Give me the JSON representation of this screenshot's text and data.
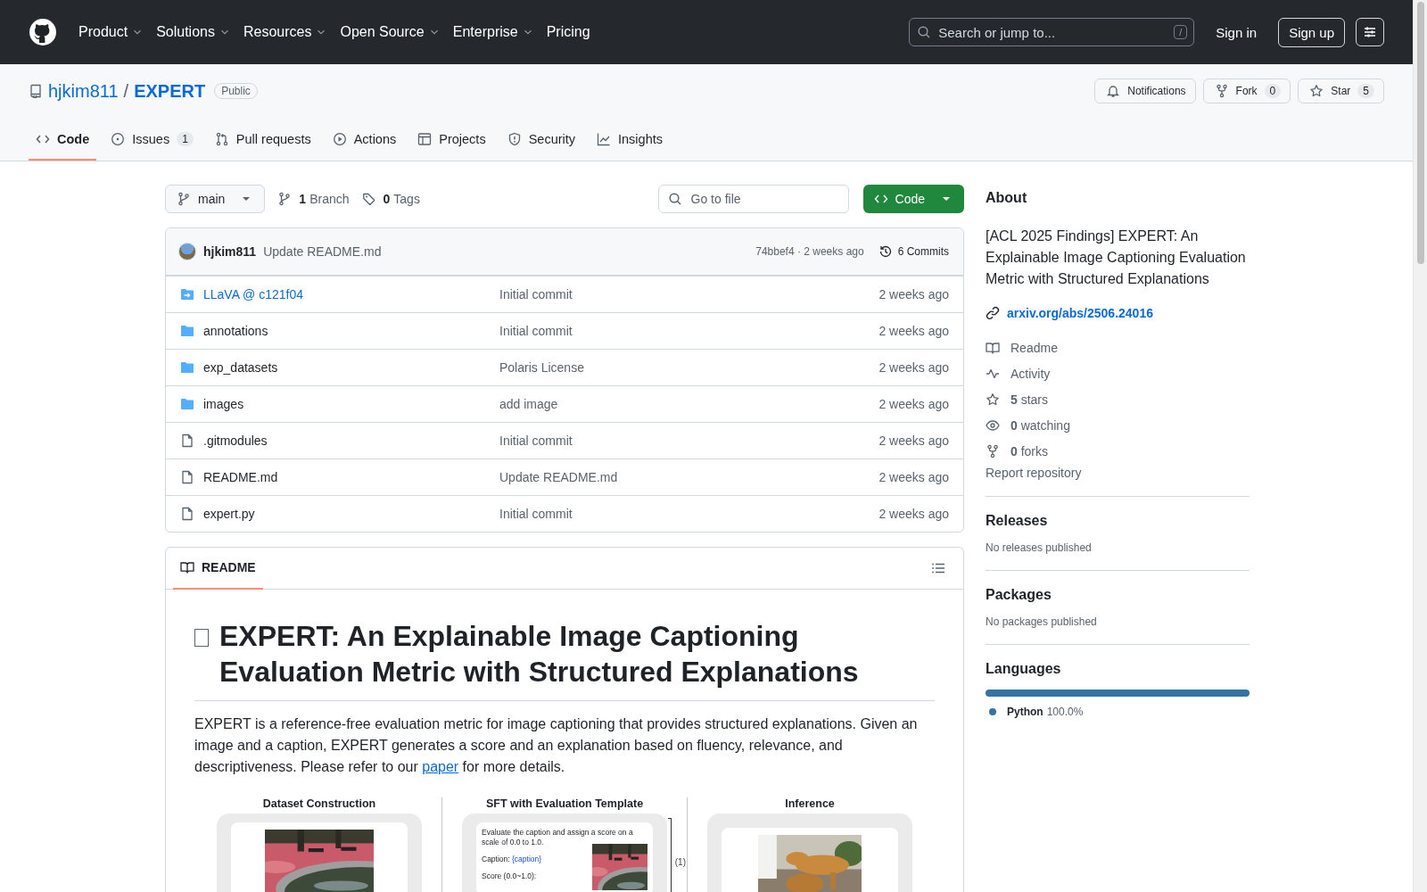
{
  "header": {
    "nav": [
      {
        "label": "Product",
        "has_menu": true
      },
      {
        "label": "Solutions",
        "has_menu": true
      },
      {
        "label": "Resources",
        "has_menu": true
      },
      {
        "label": "Open Source",
        "has_menu": true
      },
      {
        "label": "Enterprise",
        "has_menu": true
      },
      {
        "label": "Pricing",
        "has_menu": false
      }
    ],
    "search": {
      "placeholder": "Search or jump to...",
      "shortcut": "/"
    },
    "sign_in": "Sign in",
    "sign_up": "Sign up"
  },
  "repo": {
    "owner": "hjkim811",
    "separator": "/",
    "name": "EXPERT",
    "visibility": "Public",
    "actions": [
      {
        "kind": "bell",
        "label": "Notifications"
      },
      {
        "kind": "fork",
        "label": "Fork",
        "count": "0"
      },
      {
        "kind": "star",
        "label": "Star",
        "count": "5"
      }
    ]
  },
  "tabs": [
    {
      "kind": "code",
      "label": "Code",
      "selected": true
    },
    {
      "kind": "issue",
      "label": "Issues",
      "count": "1",
      "selected": false
    },
    {
      "kind": "pr",
      "label": "Pull requests",
      "selected": false
    },
    {
      "kind": "play",
      "label": "Actions",
      "selected": false
    },
    {
      "kind": "table",
      "label": "Projects",
      "selected": false
    },
    {
      "kind": "shield",
      "label": "Security",
      "selected": false
    },
    {
      "kind": "graph",
      "label": "Insights",
      "selected": false
    }
  ],
  "toolbar": {
    "branch": "main",
    "branch_count": "1",
    "branch_label": "Branch",
    "tag_count": "0",
    "tag_label": "Tags",
    "go_to_file": {
      "placeholder": "Go to file"
    },
    "code_button": "Code"
  },
  "latest_commit": {
    "author": "hjkim811",
    "message": "Update README.md",
    "meta": "74bbef4 · 2 weeks ago",
    "commits": "6 Commits"
  },
  "files": [
    {
      "kind": "submodule",
      "name": "LLaVA @ c121f04",
      "message": "Initial commit",
      "time": "2 weeks ago"
    },
    {
      "kind": "folder",
      "name": "annotations",
      "message": "Initial commit",
      "time": "2 weeks ago"
    },
    {
      "kind": "folder",
      "name": "exp_datasets",
      "message": "Polaris License",
      "time": "2 weeks ago"
    },
    {
      "kind": "folder",
      "name": "images",
      "message": "add image",
      "time": "2 weeks ago"
    },
    {
      "kind": "file",
      "name": ".gitmodules",
      "message": "Initial commit",
      "time": "2 weeks ago"
    },
    {
      "kind": "file",
      "name": "README.md",
      "message": "Update README.md",
      "time": "2 weeks ago"
    },
    {
      "kind": "file",
      "name": "expert.py",
      "message": "Initial commit",
      "time": "2 weeks ago"
    }
  ],
  "readme": {
    "tab": "README",
    "title": "EXPERT: An Explainable Image Captioning Evaluation Metric with Structured Explanations",
    "paragraph": {
      "before": "EXPERT is a reference-free evaluation metric for image captioning that provides structured explanations. Given an image and a caption, EXPERT generates a score and an explanation based on fluency, relevance, and descriptiveness. Please refer to our ",
      "link": "paper",
      "after": " for more details."
    },
    "figure": {
      "panels": [
        {
          "kind": "dataset",
          "title": "Dataset Construction"
        },
        {
          "kind": "template",
          "title": "SFT with Evaluation Template"
        },
        {
          "kind": "inference",
          "title": "Inference"
        }
      ],
      "template": {
        "instruction": "Evaluate the caption and assign a score on a scale of 0.0 to 1.0.",
        "caption_label": "Caption:",
        "caption_value": "{caption}",
        "score_label": "Score (0.0~1.0):",
        "step": "(1)"
      }
    }
  },
  "sidebar": {
    "about": {
      "heading": "About",
      "description": "[ACL 2025 Findings] EXPERT: An Explainable Image Captioning Evaluation Metric with Structured Explanations",
      "link": "arxiv.org/abs/2506.24016",
      "items": [
        {
          "kind": "book",
          "label": "Readme"
        },
        {
          "kind": "pulse",
          "label": "Activity"
        },
        {
          "kind": "star",
          "count": "5",
          "label": "stars"
        },
        {
          "kind": "eye",
          "count": "0",
          "label": "watching"
        },
        {
          "kind": "fork",
          "count": "0",
          "label": "forks"
        }
      ],
      "report": "Report repository"
    },
    "sections": [
      {
        "heading": "Releases",
        "note": "No releases published"
      },
      {
        "heading": "Packages",
        "note": "No packages published"
      }
    ],
    "languages": {
      "heading": "Languages",
      "items": [
        {
          "name": "Python",
          "percent": "100.0%",
          "level": 1.0,
          "color": "#3572a5"
        }
      ]
    }
  }
}
